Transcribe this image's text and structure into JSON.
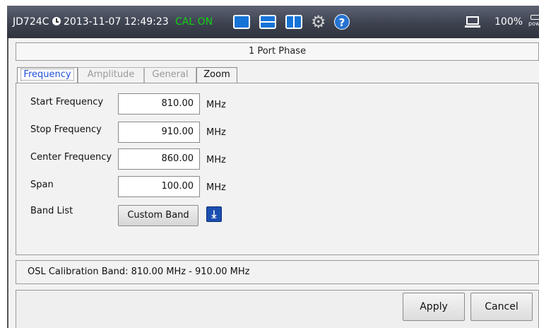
{
  "status_bar": {
    "model": "JD724C",
    "datetime": "2013-11-07 12:49:23",
    "cal_status": "CAL ON",
    "battery": "100%",
    "power_label": "power"
  },
  "header": {
    "title": "1 Port Phase"
  },
  "tabs": [
    {
      "label": "Frequency",
      "active": true
    },
    {
      "label": "Amplitude",
      "active": false
    },
    {
      "label": "General",
      "active": false
    },
    {
      "label": "Zoom",
      "active": false
    }
  ],
  "fields": {
    "start": {
      "label": "Start Frequency",
      "value": "810.00",
      "unit": "MHz"
    },
    "stop": {
      "label": "Stop Frequency",
      "value": "910.00",
      "unit": "MHz"
    },
    "center": {
      "label": "Center Frequency",
      "value": "860.00",
      "unit": "MHz"
    },
    "span": {
      "label": "Span",
      "value": "100.00",
      "unit": "MHz"
    }
  },
  "band_list": {
    "label": "Band List",
    "button": "Custom Band"
  },
  "info": {
    "text": "OSL Calibration Band: 810.00 MHz - 910.00 MHz"
  },
  "footer": {
    "apply": "Apply",
    "cancel": "Cancel"
  },
  "colors": {
    "cal_on": "#14d114",
    "active_tab": "#1f4fd6",
    "icon_blue": "#1673d6"
  }
}
